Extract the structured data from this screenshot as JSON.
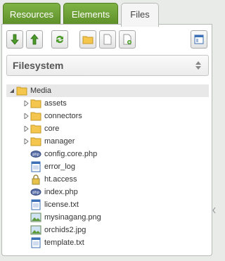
{
  "tabs": [
    {
      "label": "Resources",
      "active": false
    },
    {
      "label": "Elements",
      "active": false
    },
    {
      "label": "Files",
      "active": true
    }
  ],
  "toolbar": {
    "buttons": [
      {
        "icon": "arrow-down-icon"
      },
      {
        "icon": "arrow-up-icon"
      },
      {
        "icon": "refresh-icon"
      },
      {
        "icon": "new-folder-icon"
      },
      {
        "icon": "new-file-icon"
      },
      {
        "icon": "upload-file-icon"
      },
      {
        "icon": "sidebar-layout-icon"
      }
    ]
  },
  "source": {
    "selected": "Filesystem"
  },
  "tree": {
    "root": {
      "label": "Media",
      "icon": "folder-icon",
      "expanded": true
    },
    "folders": [
      "assets",
      "connectors",
      "core",
      "manager"
    ],
    "files": [
      {
        "label": "config.core.php",
        "icon": "php-file-icon"
      },
      {
        "label": "error_log",
        "icon": "text-file-icon"
      },
      {
        "label": "ht.access",
        "icon": "lock-file-icon"
      },
      {
        "label": "index.php",
        "icon": "php-file-icon"
      },
      {
        "label": "license.txt",
        "icon": "text-file-icon"
      },
      {
        "label": "mysinagang.png",
        "icon": "image-file-icon"
      },
      {
        "label": "orchids2.jpg",
        "icon": "image-file-icon"
      },
      {
        "label": "template.txt",
        "icon": "text-file-icon"
      }
    ]
  },
  "colors": {
    "tab_green": "#6a9e33",
    "folder": "#f4c64e",
    "accent_blue": "#3b6fb6"
  }
}
